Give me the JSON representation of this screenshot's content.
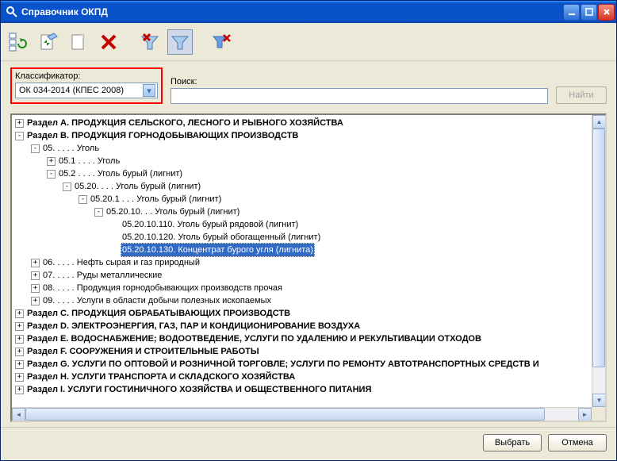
{
  "window": {
    "title": "Справочник ОКПД"
  },
  "filter": {
    "classifier_label": "Классификатор:",
    "classifier_value": "ОК 034-2014 (КПЕС 2008)",
    "search_label": "Поиск:",
    "search_value": "",
    "search_placeholder": "",
    "find_button": "Найти"
  },
  "tree": [
    {
      "level": 0,
      "exp": "+",
      "bold": true,
      "sel": false,
      "text": "Раздел A. ПРОДУКЦИЯ СЕЛЬСКОГО, ЛЕСНОГО И РЫБНОГО ХОЗЯЙСТВА"
    },
    {
      "level": 0,
      "exp": "-",
      "bold": true,
      "sel": false,
      "text": "Раздел B. ПРОДУКЦИЯ ГОРНОДОБЫВАЮЩИХ ПРОИЗВОДСТВ"
    },
    {
      "level": 1,
      "exp": "-",
      "bold": false,
      "sel": false,
      "text": "05. . . . . Уголь"
    },
    {
      "level": 2,
      "exp": "+",
      "bold": false,
      "sel": false,
      "text": "05.1 . . . . Уголь"
    },
    {
      "level": 2,
      "exp": "-",
      "bold": false,
      "sel": false,
      "text": "05.2 . . . . Уголь бурый (лигнит)"
    },
    {
      "level": 3,
      "exp": "-",
      "bold": false,
      "sel": false,
      "text": "05.20. . . . Уголь бурый (лигнит)"
    },
    {
      "level": 4,
      "exp": "-",
      "bold": false,
      "sel": false,
      "text": "05.20.1 . . . Уголь бурый (лигнит)"
    },
    {
      "level": 5,
      "exp": "-",
      "bold": false,
      "sel": false,
      "text": "05.20.10. . . Уголь бурый (лигнит)"
    },
    {
      "level": 6,
      "exp": "",
      "bold": false,
      "sel": false,
      "text": "05.20.10.110. Уголь бурый рядовой (лигнит)"
    },
    {
      "level": 6,
      "exp": "",
      "bold": false,
      "sel": false,
      "text": "05.20.10.120. Уголь бурый обогащенный (лигнит)"
    },
    {
      "level": 6,
      "exp": "",
      "bold": false,
      "sel": true,
      "text": "05.20.10.130. Концентрат бурого угля (лигнита)"
    },
    {
      "level": 1,
      "exp": "+",
      "bold": false,
      "sel": false,
      "text": "06. . . . . Нефть сырая и газ природный"
    },
    {
      "level": 1,
      "exp": "+",
      "bold": false,
      "sel": false,
      "text": "07. . . . . Руды металлические"
    },
    {
      "level": 1,
      "exp": "+",
      "bold": false,
      "sel": false,
      "text": "08. . . . . Продукция горнодобывающих производств прочая"
    },
    {
      "level": 1,
      "exp": "+",
      "bold": false,
      "sel": false,
      "text": "09. . . . . Услуги в области добычи полезных ископаемых"
    },
    {
      "level": 0,
      "exp": "+",
      "bold": true,
      "sel": false,
      "text": "Раздел C. ПРОДУКЦИЯ ОБРАБАТЫВАЮЩИХ ПРОИЗВОДСТВ"
    },
    {
      "level": 0,
      "exp": "+",
      "bold": true,
      "sel": false,
      "text": "Раздел D. ЭЛЕКТРОЭНЕРГИЯ, ГАЗ, ПАР И КОНДИЦИОНИРОВАНИЕ ВОЗДУХА"
    },
    {
      "level": 0,
      "exp": "+",
      "bold": true,
      "sel": false,
      "text": "Раздел E. ВОДОСНАБЖЕНИЕ; ВОДООТВЕДЕНИЕ, УСЛУГИ ПО УДАЛЕНИЮ И РЕКУЛЬТИВАЦИИ ОТХОДОВ"
    },
    {
      "level": 0,
      "exp": "+",
      "bold": true,
      "sel": false,
      "text": "Раздел F. СООРУЖЕНИЯ И СТРОИТЕЛЬНЫЕ РАБОТЫ"
    },
    {
      "level": 0,
      "exp": "+",
      "bold": true,
      "sel": false,
      "text": "Раздел G. УСЛУГИ ПО ОПТОВОЙ И РОЗНИЧНОЙ ТОРГОВЛЕ; УСЛУГИ ПО РЕМОНТУ АВТОТРАНСПОРТНЫХ СРЕДСТВ И"
    },
    {
      "level": 0,
      "exp": "+",
      "bold": true,
      "sel": false,
      "text": "Раздел H. УСЛУГИ ТРАНСПОРТА И СКЛАДСКОГО ХОЗЯЙСТВА"
    },
    {
      "level": 0,
      "exp": "+",
      "bold": true,
      "sel": false,
      "text": "Раздел I. УСЛУГИ ГОСТИНИЧНОГО ХОЗЯЙСТВА И ОБЩЕСТВЕННОГО ПИТАНИЯ"
    }
  ],
  "footer": {
    "select": "Выбрать",
    "cancel": "Отмена"
  }
}
